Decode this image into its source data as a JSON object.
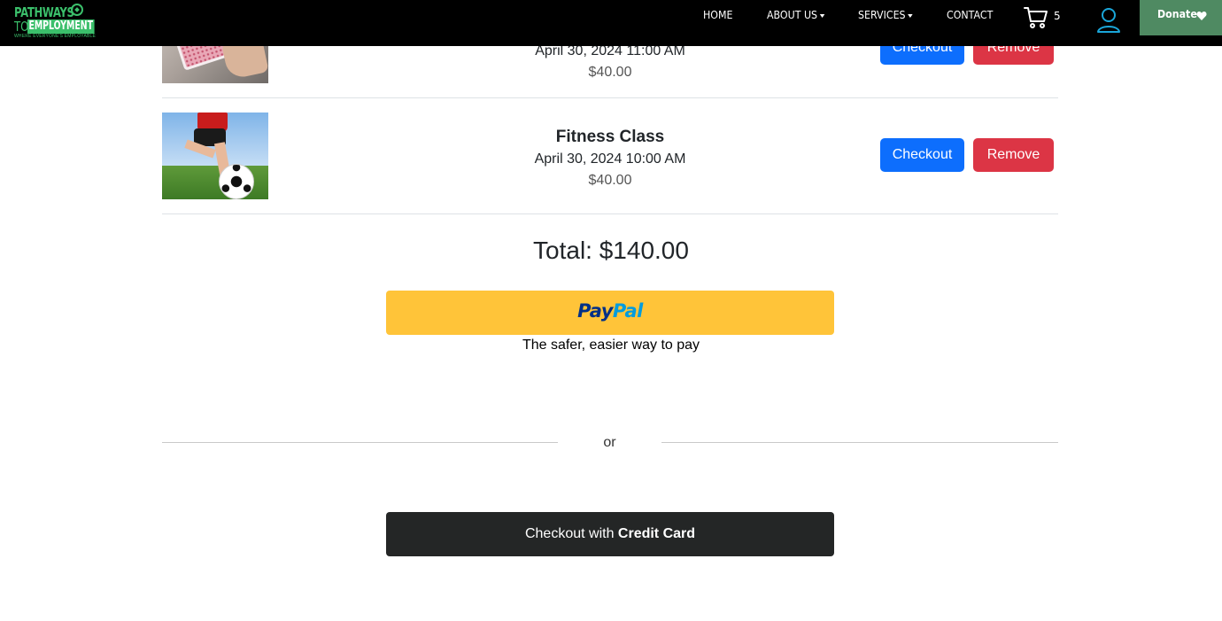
{
  "navbar": {
    "logo": {
      "line1": "PATHWAYS",
      "line2_to": "TO",
      "line2_employment": "EMPLOYMENT",
      "tagline": "WHERE EVERYONE'S EMPLOYABLE"
    },
    "links": {
      "home": "HOME",
      "about": "ABOUT US",
      "services": "SERVICES",
      "contact": "CONTACT"
    },
    "cart_count": "5",
    "donate_label": "Donate",
    "icons": {
      "cart": "cart-icon",
      "user": "user-icon",
      "heart": "heart-icon",
      "caret": "caret-down-icon"
    },
    "colors": {
      "brand_green": "#3bbf6b",
      "donate_bg": "#4f8a62",
      "user_icon": "#1aa6d9"
    }
  },
  "cart": {
    "items": [
      {
        "title": "",
        "date": "April 30, 2024 11:00 AM",
        "price": "$40.00"
      },
      {
        "title": "Fitness Class",
        "date": "April 30, 2024 10:00 AM",
        "price": "$40.00"
      }
    ],
    "checkout_label": "Checkout",
    "remove_label": "Remove",
    "colors": {
      "checkout": "#0d6efd",
      "remove": "#dc3545"
    }
  },
  "total_label": "Total: $140.00",
  "paypal": {
    "logo_part1": "Pay",
    "logo_part2": "Pal",
    "tagline": "The safer, easier way to pay",
    "button_color": "#ffc439"
  },
  "divider_text": "or",
  "credit_card": {
    "prefix": "Checkout with ",
    "emphasis": "Credit Card",
    "button_color": "#242626"
  }
}
